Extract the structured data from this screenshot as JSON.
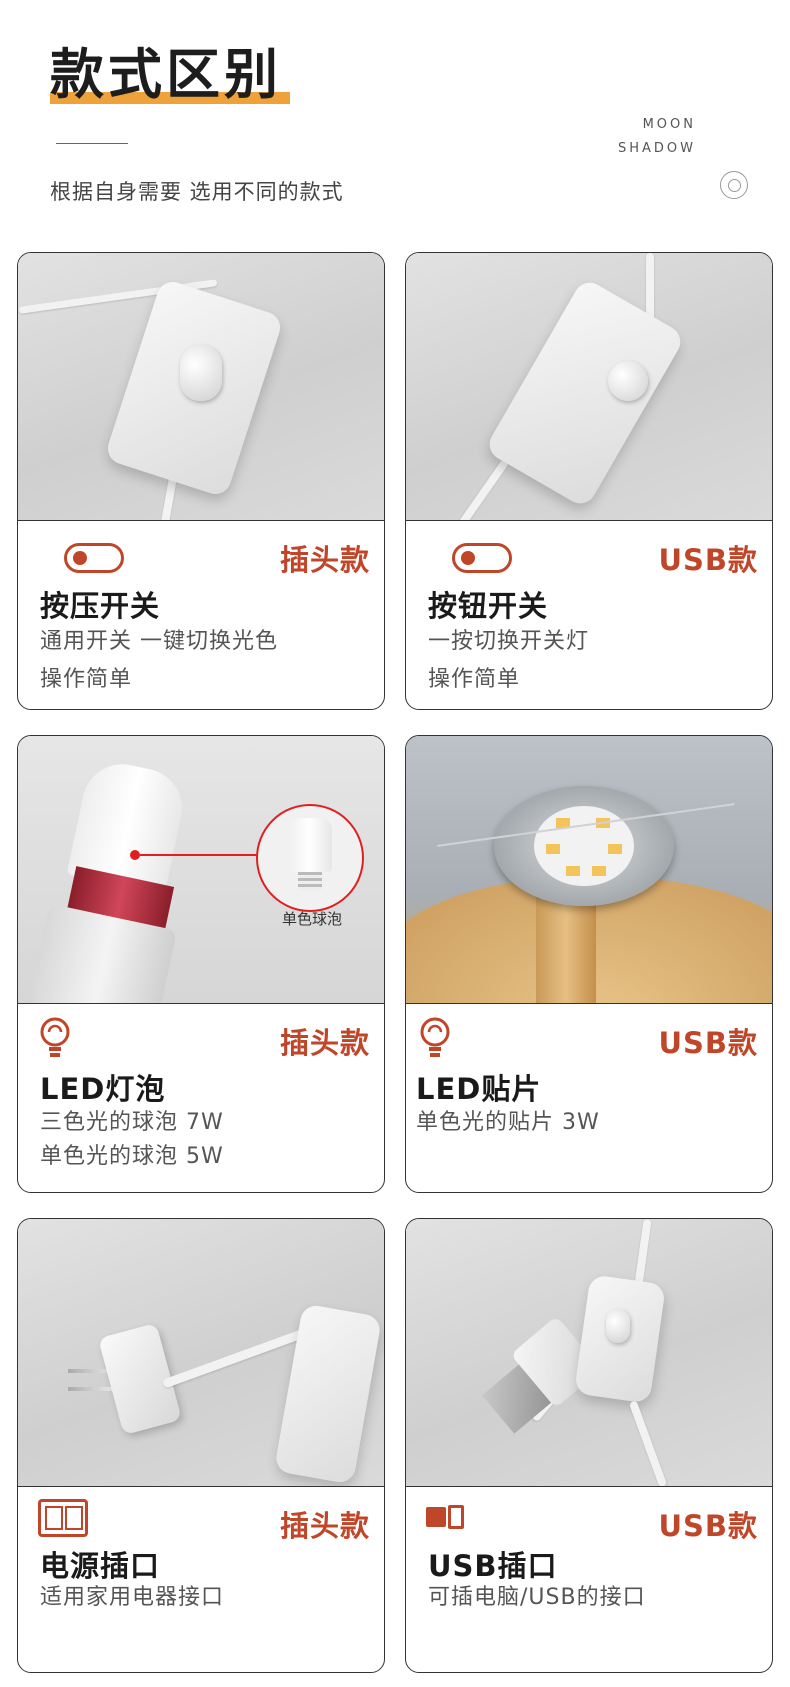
{
  "header": {
    "title": "款式区别",
    "subtitle": "根据自身需要 选用不同的款式",
    "brand_line1": "MOON",
    "brand_line2": "SHADOW"
  },
  "cards": [
    {
      "tag": "插头款",
      "name": "按压开关",
      "desc1": "通用开关 一键切换光色",
      "desc2": "操作简单",
      "icon": "toggle-switch-icon"
    },
    {
      "tag": "USB款",
      "name": "按钮开关",
      "desc1": "一按切换开关灯",
      "desc2": "操作简单",
      "icon": "toggle-switch-icon"
    },
    {
      "tag": "插头款",
      "name": "LED灯泡",
      "desc1": "三色光的球泡 7W",
      "desc2": "单色光的球泡 5W",
      "icon": "light-bulb-icon",
      "inset_label": "单色球泡"
    },
    {
      "tag": "USB款",
      "name": "LED贴片",
      "desc1": "单色光的贴片 3W",
      "icon": "light-bulb-icon"
    },
    {
      "tag": "插头款",
      "name": "电源插口",
      "desc1": "适用家用电器接口",
      "icon": "power-outlet-icon"
    },
    {
      "tag": "USB款",
      "name": "USB插口",
      "desc1": "可插电脑/USB的接口",
      "icon": "usb-port-icon"
    }
  ],
  "colors": {
    "accent": "#c0462a",
    "highlight": "#f0a23a",
    "border": "#333333"
  }
}
